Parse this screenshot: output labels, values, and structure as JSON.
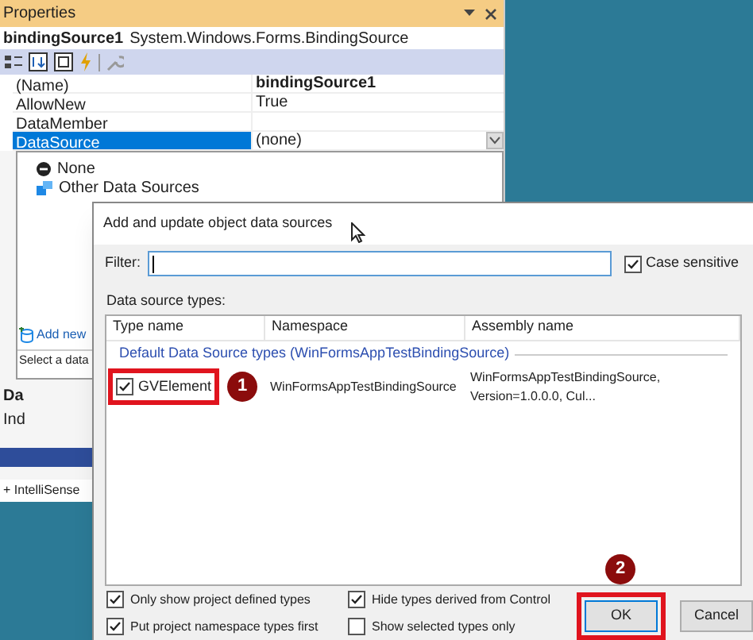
{
  "properties_panel": {
    "title": "Properties",
    "object_name": "bindingSource1",
    "object_type": "System.Windows.Forms.BindingSource",
    "rows": [
      {
        "name": "(Name)",
        "value": "bindingSource1",
        "bold": true,
        "selected": false
      },
      {
        "name": "AllowNew",
        "value": "True",
        "bold": false,
        "selected": false
      },
      {
        "name": "DataMember",
        "selected": false
      },
      {
        "name": "DataSource",
        "value": "(none)",
        "bold": false,
        "selected": true
      }
    ],
    "dropdown_items": [
      {
        "label": "None",
        "kind": "none"
      },
      {
        "label": "Other Data Sources",
        "kind": "sources"
      }
    ],
    "add_new_link": "Add new",
    "dropdown_hint": "Select a data",
    "description_title": "Da",
    "description_text": "Ind",
    "intellisense": "+ IntelliSense"
  },
  "dialog": {
    "title": "Add and update object data sources",
    "filter_label": "Filter:",
    "case_sensitive": {
      "label": "Case sensitive",
      "checked": true
    },
    "list_label": "Data source types:",
    "columns": [
      "Type name",
      "Namespace",
      "Assembly name"
    ],
    "group": "Default Data Source types (WinFormsAppTestBindingSource)",
    "rows": [
      {
        "type_name": "GVElement",
        "namespace": "WinFormsAppTestBindingSource",
        "assembly": "WinFormsAppTestBindingSource, Version=1.0.0.0, Cul...",
        "checked": true,
        "highlighted": true,
        "annotation": "1"
      }
    ],
    "options": [
      {
        "label": "Only show project defined types",
        "checked": true
      },
      {
        "label": "Hide types derived from Control",
        "checked": true
      },
      {
        "label": "Put project namespace types first",
        "checked": true
      },
      {
        "label": "Show selected types only",
        "checked": false
      }
    ],
    "buttons": [
      {
        "label": "OK",
        "default": true,
        "highlighted": true,
        "annotation": "2"
      },
      {
        "label": "Cancel",
        "default": false,
        "highlighted": false
      }
    ]
  }
}
